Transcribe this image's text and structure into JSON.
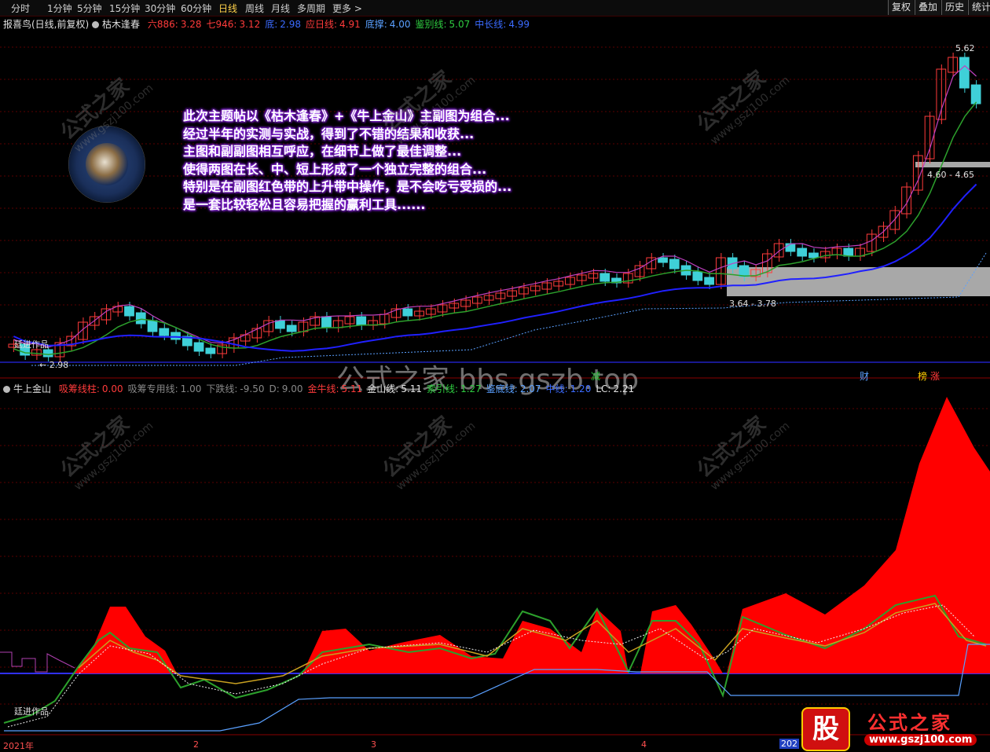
{
  "toolbar": {
    "tabs": [
      "分时",
      "1分钟",
      "5分钟",
      "15分钟",
      "30分钟",
      "60分钟",
      "日线",
      "周线",
      "月线",
      "多周期",
      "更多 >"
    ],
    "active_tab": "日线",
    "right_buttons": [
      "复权",
      "叠加",
      "历史",
      "统计"
    ]
  },
  "main_header": {
    "stock": "报喜鸟(日线,前复权)",
    "indicator": "枯木逢春",
    "items": [
      {
        "label": "六886:",
        "value": "3.28",
        "color": "#ff3b3b"
      },
      {
        "label": "七946:",
        "value": "3.12",
        "color": "#ff3b3b"
      },
      {
        "label": "底:",
        "value": "2.98",
        "color": "#3b6bff"
      },
      {
        "label": "应日线:",
        "value": "4.91",
        "color": "#ff3b3b"
      },
      {
        "label": "底撑:",
        "value": "4.00",
        "color": "#5aa0ff"
      },
      {
        "label": "鉴别线:",
        "value": "5.07",
        "color": "#2ecc40"
      },
      {
        "label": "中长线:",
        "value": "4.99",
        "color": "#3b6bff"
      }
    ]
  },
  "overlay_lines": [
    "此次主题帖以《枯木逢春》+《牛上金山》主副图为组合...",
    "经过半年的实测与实战，得到了不错的结果和收获...",
    "主图和副副图相互呼应，在细节上做了最佳调整...",
    "使得两图在长、中、短上形成了一个独立完整的组合...",
    "特别是在副图红色带的上升带中操作，是不会吃亏受损的...",
    "是一套比较轻松且容易把握的赢利工具......"
  ],
  "main_annotations": {
    "left_label": "廷进作品",
    "low_price": "← 2.98",
    "high_price": "5.62",
    "band_high": "4.60 - 4.65",
    "band_low": "3.64 - 3.78",
    "markers": [
      {
        "text": "减",
        "color": "#2ecc40"
      },
      {
        "text": "财",
        "color": "#5aa0ff"
      },
      {
        "text": "榜",
        "color": "#ffcc00"
      },
      {
        "text": "涨",
        "color": "#ff3b3b"
      }
    ]
  },
  "watermark_bbs": "公式之家 bbs.gszb.top",
  "watermark_site": {
    "name": "公式之家",
    "url": "www.gszj100.com"
  },
  "sub_header": {
    "indicator": "牛上金山",
    "items": [
      {
        "label": "吸筹线柱:",
        "value": "0.00",
        "color": "#ff3b3b"
      },
      {
        "label": "吸筹专用线:",
        "value": "1.00",
        "color": "#888888"
      },
      {
        "label": "下跌线:",
        "value": "-9.50",
        "color": "#888888"
      },
      {
        "label": "D:",
        "value": "9.00",
        "color": "#888888"
      },
      {
        "label": "金牛线:",
        "value": "5.11",
        "color": "#ff3b3b"
      },
      {
        "label": "金山线:",
        "value": "5.11",
        "color": "#e0e0e0"
      },
      {
        "label": "索引线:",
        "value": "1.27",
        "color": "#2ecc40"
      },
      {
        "label": "鉴底线:",
        "value": "2.07",
        "color": "#5aa0ff"
      },
      {
        "label": "中线:",
        "value": "1.20",
        "color": "#3b6bff"
      },
      {
        "label": "LC:",
        "value": "2.21",
        "color": "#e0e0e0"
      }
    ],
    "left_label": "廷进作品"
  },
  "time_axis": [
    "2021年",
    "2",
    "3",
    "4",
    "202"
  ],
  "bottom_logo": {
    "char": "股",
    "name": "公式之家",
    "url": "www.gszj100.com"
  },
  "colors": {
    "up": "#ff3b3b",
    "down": "#3fd0d8",
    "ma_short": "#c040c0",
    "ma_mid": "#2ca02c",
    "ma_long": "#2020ff",
    "area": "#ff0000"
  }
}
